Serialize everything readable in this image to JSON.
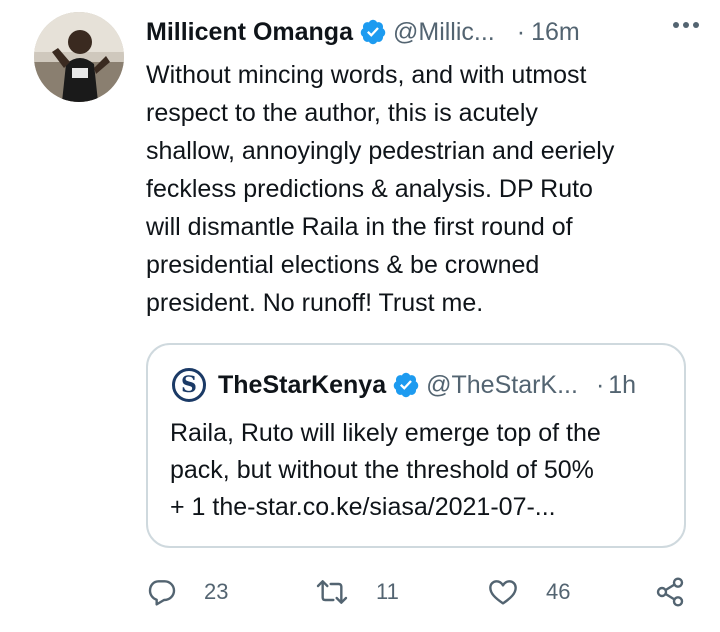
{
  "tweet": {
    "author_name": "Millicent Omanga",
    "author_handle": "@Millic...",
    "separator": "·",
    "time": "16m",
    "text_lines": [
      "Without mincing words, and with utmost",
      "respect to the author, this is acutely",
      "shallow, annoyingly pedestrian and eeriely",
      "feckless predictions & analysis. DP Ruto",
      "will dismantle Raila in the first round of",
      "presidential elections & be crowned",
      "president. No runoff! Trust me."
    ]
  },
  "quoted_tweet": {
    "logo_letter": "S",
    "author_name": "TheStarKenya",
    "author_handle": "@TheStarK...",
    "separator": "·",
    "time": "1h",
    "text_lines": [
      "Raila, Ruto will likely emerge top of the",
      "pack, but without the threshold of 50%",
      "+ 1 the-star.co.ke/siasa/2021-07-..."
    ]
  },
  "actions": {
    "reply_count": "23",
    "retweet_count": "11",
    "like_count": "46"
  },
  "icons": {
    "verified": "verified-badge-icon",
    "more": "more-options-icon",
    "reply": "reply-icon",
    "retweet": "retweet-icon",
    "like": "heart-icon",
    "share": "share-icon"
  },
  "colors": {
    "verified": "#1d9bf0",
    "secondary_text": "#536471",
    "border": "#cfd9de"
  }
}
